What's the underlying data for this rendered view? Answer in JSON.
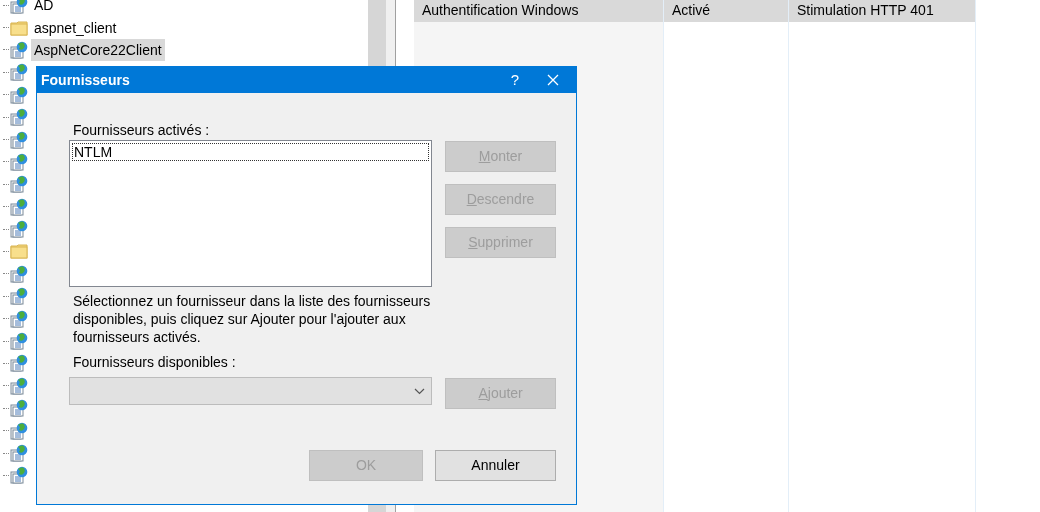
{
  "tree": {
    "items": [
      {
        "kind": "site",
        "label": "AD",
        "selected": false
      },
      {
        "kind": "folder",
        "label": "aspnet_client",
        "selected": false
      },
      {
        "kind": "site",
        "label": "AspNetCore22Client",
        "selected": true
      },
      {
        "kind": "site"
      },
      {
        "kind": "site"
      },
      {
        "kind": "site"
      },
      {
        "kind": "site"
      },
      {
        "kind": "site"
      },
      {
        "kind": "site"
      },
      {
        "kind": "site"
      },
      {
        "kind": "site"
      },
      {
        "kind": "folder"
      },
      {
        "kind": "site"
      },
      {
        "kind": "site"
      },
      {
        "kind": "site"
      },
      {
        "kind": "site"
      },
      {
        "kind": "site"
      },
      {
        "kind": "site"
      },
      {
        "kind": "site"
      },
      {
        "kind": "site"
      },
      {
        "kind": "site"
      },
      {
        "kind": "site"
      }
    ]
  },
  "table": {
    "columns": [
      "Authentification Windows",
      "Activé",
      "Stimulation HTTP 401"
    ]
  },
  "dialog": {
    "title": "Fournisseurs",
    "help": "?",
    "enabled_label": "Fournisseurs activés :",
    "enabled_list": [
      {
        "label": "NTLM",
        "focused": true
      }
    ],
    "side_buttons": [
      {
        "label": "Monter",
        "disabled": true,
        "underline_first": true
      },
      {
        "label": "Descendre",
        "disabled": true,
        "underline_first": true
      },
      {
        "label": "Supprimer",
        "disabled": true,
        "underline_first": true
      }
    ],
    "instructions": "Sélectionnez un fournisseur dans la liste des fournisseurs disponibles, puis cliquez sur Ajouter pour l'ajouter aux fournisseurs activés.",
    "available_label": "Fournisseurs disponibles :",
    "available_combo": {
      "disabled": true
    },
    "add_button": {
      "label": "Ajouter",
      "disabled": true,
      "underline_first": true
    },
    "footer_buttons": [
      {
        "label": "OK",
        "disabled": true,
        "underline_first": false
      },
      {
        "label": "Annuler",
        "disabled": false,
        "underline_first": false
      }
    ]
  }
}
